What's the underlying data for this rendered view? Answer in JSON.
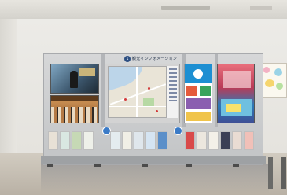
{
  "scene": {
    "kiosk_header_number": "1",
    "kiosk_header_text": "観光インフォメーション"
  },
  "colors": {
    "kiosk_frame": "#c2c4c6",
    "badge_blue": "#3b7bc7",
    "wall": "#ecebe7",
    "floor": "#c6bfb3"
  },
  "objects": [
    "ceiling-vent-icon",
    "video-screen-1",
    "video-screen-2",
    "map-panel",
    "info-poster",
    "video-screen-right",
    "brochure-rack-icon",
    "wall-poster",
    "stanchion-pole-icon"
  ]
}
